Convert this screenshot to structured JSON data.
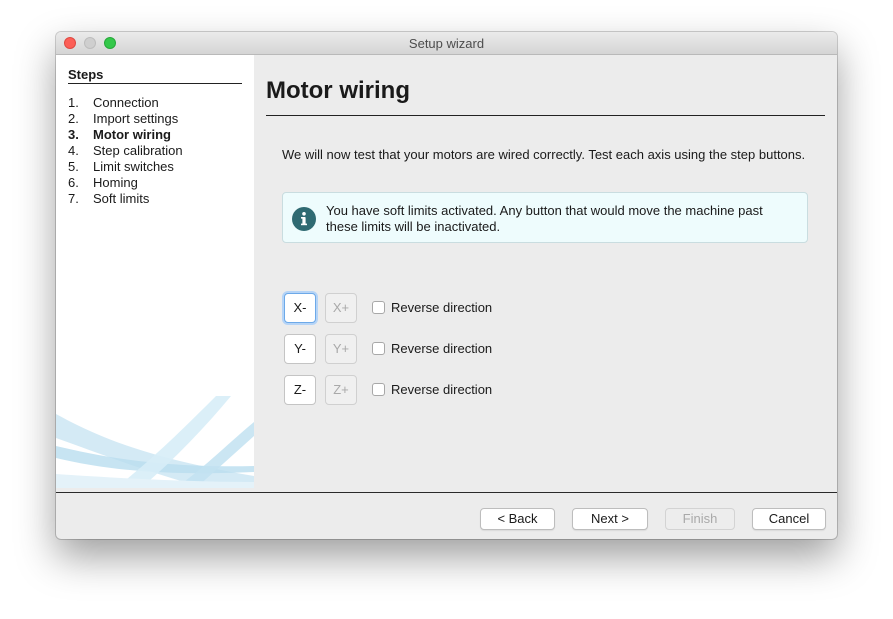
{
  "window": {
    "title": "Setup wizard"
  },
  "sidebar": {
    "title": "Steps",
    "items": [
      {
        "num": "1.",
        "label": "Connection"
      },
      {
        "num": "2.",
        "label": "Import settings"
      },
      {
        "num": "3.",
        "label": "Motor wiring",
        "active": true
      },
      {
        "num": "4.",
        "label": "Step calibration"
      },
      {
        "num": "5.",
        "label": "Limit switches"
      },
      {
        "num": "6.",
        "label": "Homing"
      },
      {
        "num": "7.",
        "label": "Soft limits"
      }
    ]
  },
  "main": {
    "title": "Motor wiring",
    "intro": "We will now test that your motors are wired correctly. Test each axis using the step buttons.",
    "info": "You have soft limits activated. Any button that would move the machine past these limits will be inactivated.",
    "axes": [
      {
        "minus": "X-",
        "plus": "X+",
        "reverse_label": "Reverse direction",
        "reverse_checked": false
      },
      {
        "minus": "Y-",
        "plus": "Y+",
        "reverse_label": "Reverse direction",
        "reverse_checked": false
      },
      {
        "minus": "Z-",
        "plus": "Z+",
        "reverse_label": "Reverse direction",
        "reverse_checked": false
      }
    ]
  },
  "footer": {
    "back": "< Back",
    "next": "Next >",
    "finish": "Finish",
    "cancel": "Cancel"
  },
  "colors": {
    "info_bg": "#eefcfd",
    "info_icon": "#2f6a72",
    "focus_ring": "#6da9e8"
  }
}
